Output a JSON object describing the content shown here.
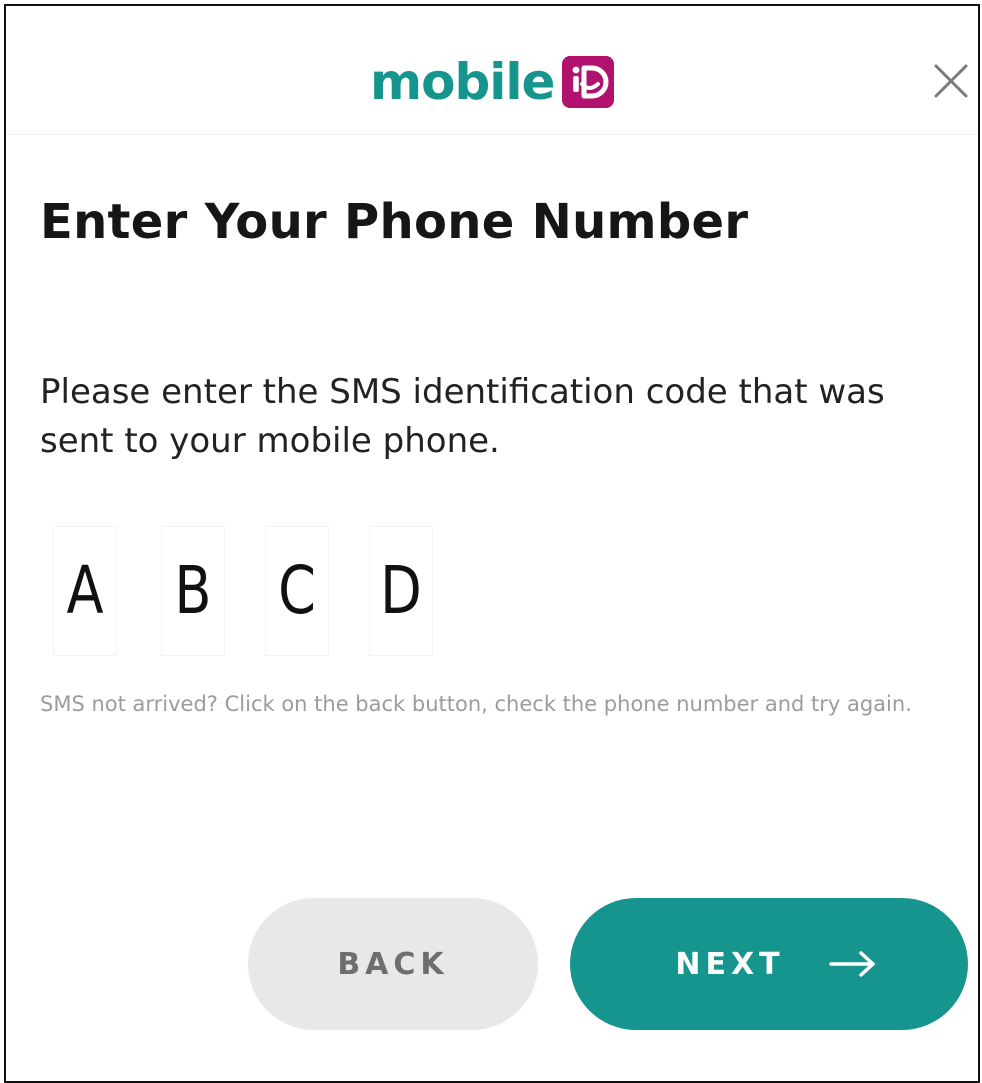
{
  "brand": {
    "logo_text": "mobile",
    "badge_icon": "id-badge-icon",
    "colors": {
      "teal": "#16958f",
      "magenta": "#b0126e"
    }
  },
  "header": {
    "close_icon": "close-icon"
  },
  "page": {
    "title": "Enter Your Phone Number",
    "instructions": "Please enter the SMS identification code that was sent to your mobile phone.",
    "code_digits": [
      "A",
      "B",
      "C",
      "D"
    ],
    "hint": "SMS not arrived? Click on the back button, check the phone number and try again."
  },
  "actions": {
    "back_label": "BACK",
    "next_label": "NEXT",
    "next_icon": "arrow-right-icon"
  }
}
